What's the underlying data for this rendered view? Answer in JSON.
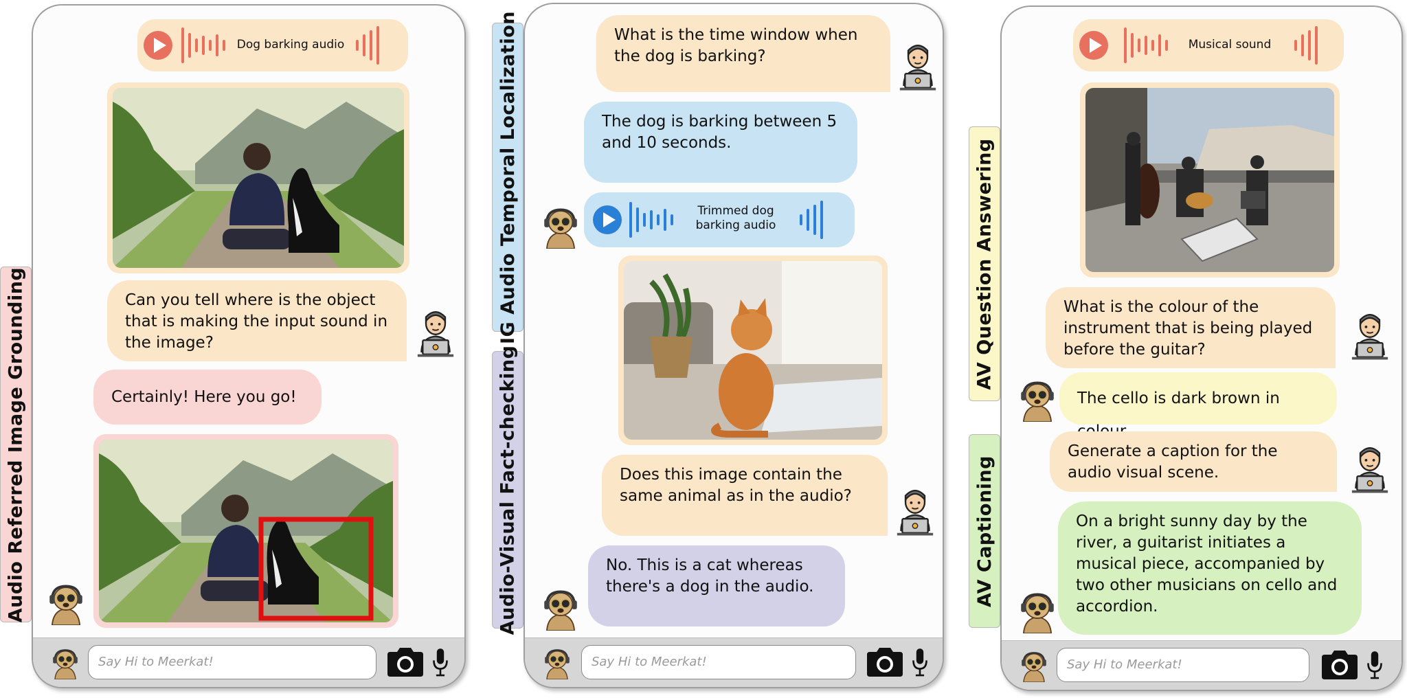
{
  "tags": {
    "left": "Audio Referred Image Grounding",
    "mid_top": "IG Audio Temporal Localization",
    "mid_bottom": "Audio-Visual Fact-checking",
    "right_top": "AV Question Answering",
    "right_bottom": "AV Captioning"
  },
  "panel1": {
    "audio_label": "Dog barking audio",
    "user_question": "Can you tell where is the object that is making the input sound in the image?",
    "bot_reply": "Certainly! Here you go!",
    "input_placeholder": "Say Hi to Meerkat!"
  },
  "panel2": {
    "user_question_1": "What is the time window when the dog is barking?",
    "bot_reply_1": "The dog is barking between 5 and 10 seconds.",
    "audio_label": "Trimmed dog barking audio",
    "user_question_2": "Does this image contain the same animal as in the audio?",
    "bot_reply_2": "No. This is a cat whereas there's a dog in the audio.",
    "input_placeholder": "Say Hi to Meerkat!"
  },
  "panel3": {
    "audio_label": "Musical sound",
    "user_question_1": "What is the colour of the instrument that is being played before the guitar?",
    "bot_reply_1": "The cello is dark brown in colour.",
    "user_question_2": "Generate a caption for the audio visual scene.",
    "bot_reply_2": "On a bright sunny day by the river, a guitarist initiates a musical piece, accompanied by two other musicians on cello and accordion.",
    "input_placeholder": "Say Hi to Meerkat!"
  },
  "colors": {
    "user_bubble": "#fbe6c8",
    "audio_red": "#e8705f",
    "audio_blue": "#2a7fd6",
    "bbox": "#e01010"
  }
}
